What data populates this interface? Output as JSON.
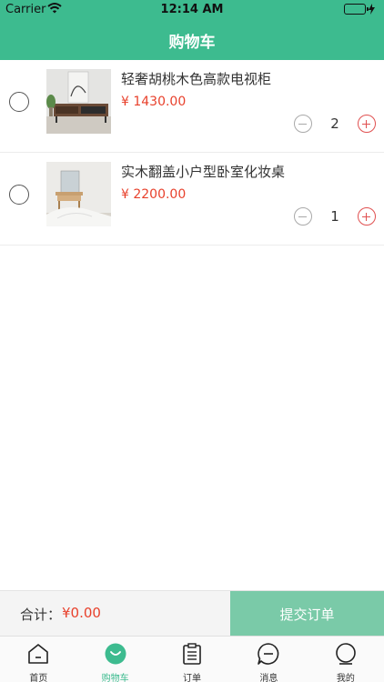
{
  "status_bar": {
    "carrier": "Carrier",
    "time": "12:14 AM",
    "battery_level": 1.0
  },
  "nav": {
    "title": "购物车"
  },
  "cart": {
    "items": [
      {
        "title": "轻奢胡桃木色高款电视柜",
        "price": "¥ 1430.00",
        "quantity": "2",
        "selected": false,
        "image": "tv-cabinet-photo"
      },
      {
        "title": "实木翻盖小户型卧室化妆桌",
        "price": "¥ 2200.00",
        "quantity": "1",
        "selected": false,
        "image": "vanity-desk-photo"
      }
    ]
  },
  "checkout": {
    "total_label": "合计：",
    "total_amount": "¥0.00",
    "submit_label": "提交订单"
  },
  "tabs": [
    {
      "label": "首页",
      "icon": "home-icon",
      "active": false
    },
    {
      "label": "购物车",
      "icon": "cart-icon",
      "active": true
    },
    {
      "label": "订单",
      "icon": "clipboard-icon",
      "active": false
    },
    {
      "label": "消息",
      "icon": "message-icon",
      "active": false
    },
    {
      "label": "我的",
      "icon": "profile-icon",
      "active": false
    }
  ],
  "colors": {
    "brand": "#3dbb8f",
    "price": "#e8412c",
    "submit_button": "#7acaa8",
    "plus": "#e05050",
    "minus": "#a9a9a9"
  }
}
